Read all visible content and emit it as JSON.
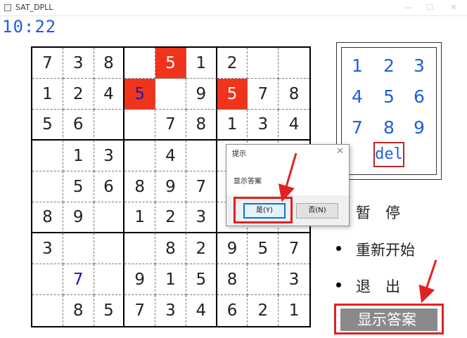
{
  "window": {
    "title": "SAT_DPLL",
    "minimize": "—",
    "maximize": "☐",
    "close": "✕"
  },
  "clock": "10:22",
  "board": {
    "cells": [
      [
        "7",
        "3",
        "8",
        "",
        "5",
        "1",
        "2",
        "",
        ""
      ],
      [
        "1",
        "2",
        "4",
        "5",
        "",
        "9",
        "5",
        "7",
        "8"
      ],
      [
        "5",
        "6",
        "",
        "",
        "7",
        "8",
        "1",
        "3",
        "4"
      ],
      [
        "",
        "1",
        "3",
        "",
        "4",
        "",
        "",
        "",
        ""
      ],
      [
        "",
        "5",
        "6",
        "8",
        "9",
        "7",
        "",
        "",
        ""
      ],
      [
        "8",
        "9",
        "",
        "1",
        "2",
        "3",
        "",
        "",
        ""
      ],
      [
        "3",
        "",
        "",
        "",
        "8",
        "2",
        "9",
        "5",
        "7"
      ],
      [
        "",
        "7",
        "",
        "9",
        "1",
        "5",
        "8",
        "",
        "3"
      ],
      [
        "",
        "8",
        "5",
        "7",
        "3",
        "4",
        "6",
        "2",
        "1"
      ]
    ],
    "highlighted": [
      [
        0,
        4
      ],
      [
        1,
        3
      ],
      [
        1,
        6
      ]
    ],
    "blue_cells": [
      [
        1,
        3
      ],
      [
        7,
        1
      ]
    ]
  },
  "keypad": {
    "digits": [
      "1",
      "2",
      "3",
      "4",
      "5",
      "6",
      "7",
      "8",
      "9"
    ],
    "del_label": "del"
  },
  "menu": {
    "pause": "暂　停",
    "restart": "重新开始",
    "quit": "退　出",
    "show_answer": "显示答案"
  },
  "dialog": {
    "title": "提示",
    "close": "✕",
    "message": "显示答案",
    "yes_label": "是(Y)",
    "no_label": "否(N)"
  },
  "colors": {
    "accent_blue": "#1f5fe0",
    "highlight_red": "#f0341b",
    "annotation_red": "#e02222"
  }
}
